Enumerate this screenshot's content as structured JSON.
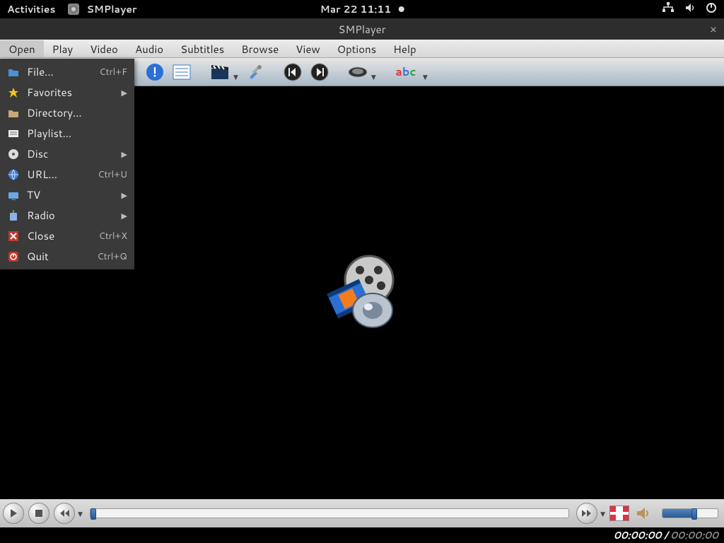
{
  "topbar": {
    "activities": "Activities",
    "app_name": "SMPlayer",
    "datetime": "Mar 22  11:11"
  },
  "window": {
    "title": "SMPlayer"
  },
  "menubar": {
    "items": [
      "Open",
      "Play",
      "Video",
      "Audio",
      "Subtitles",
      "Browse",
      "View",
      "Options",
      "Help"
    ],
    "active_index": 0
  },
  "open_menu": {
    "items": [
      {
        "icon": "folder-icon",
        "label": "File...",
        "shortcut": "Ctrl+F",
        "submenu": false
      },
      {
        "icon": "star-icon",
        "label": "Favorites",
        "shortcut": "",
        "submenu": true
      },
      {
        "icon": "directory-icon",
        "label": "Directory...",
        "shortcut": "",
        "submenu": false
      },
      {
        "icon": "playlist-icon",
        "label": "Playlist...",
        "shortcut": "",
        "submenu": false
      },
      {
        "icon": "disc-icon",
        "label": "Disc",
        "shortcut": "",
        "submenu": true
      },
      {
        "icon": "url-icon",
        "label": "URL...",
        "shortcut": "Ctrl+U",
        "submenu": false
      },
      {
        "icon": "tv-icon",
        "label": "TV",
        "shortcut": "",
        "submenu": true
      },
      {
        "icon": "radio-icon",
        "label": "Radio",
        "shortcut": "",
        "submenu": true
      },
      {
        "icon": "close-icon",
        "label": "Close",
        "shortcut": "Ctrl+X",
        "submenu": false
      },
      {
        "icon": "quit-icon",
        "label": "Quit",
        "shortcut": "Ctrl+Q",
        "submenu": false
      }
    ]
  },
  "toolbar_icons": [
    "open-file-icon",
    "open-folder-icon",
    "info-icon",
    "playlist-toolbar-icon",
    "clapper-icon",
    "tools-icon",
    "prev-track-icon",
    "next-track-icon",
    "aspect-icon",
    "subtitle-abc-icon"
  ],
  "status": {
    "current": "00:00:00",
    "separator": " / ",
    "total": "00:00:00"
  }
}
